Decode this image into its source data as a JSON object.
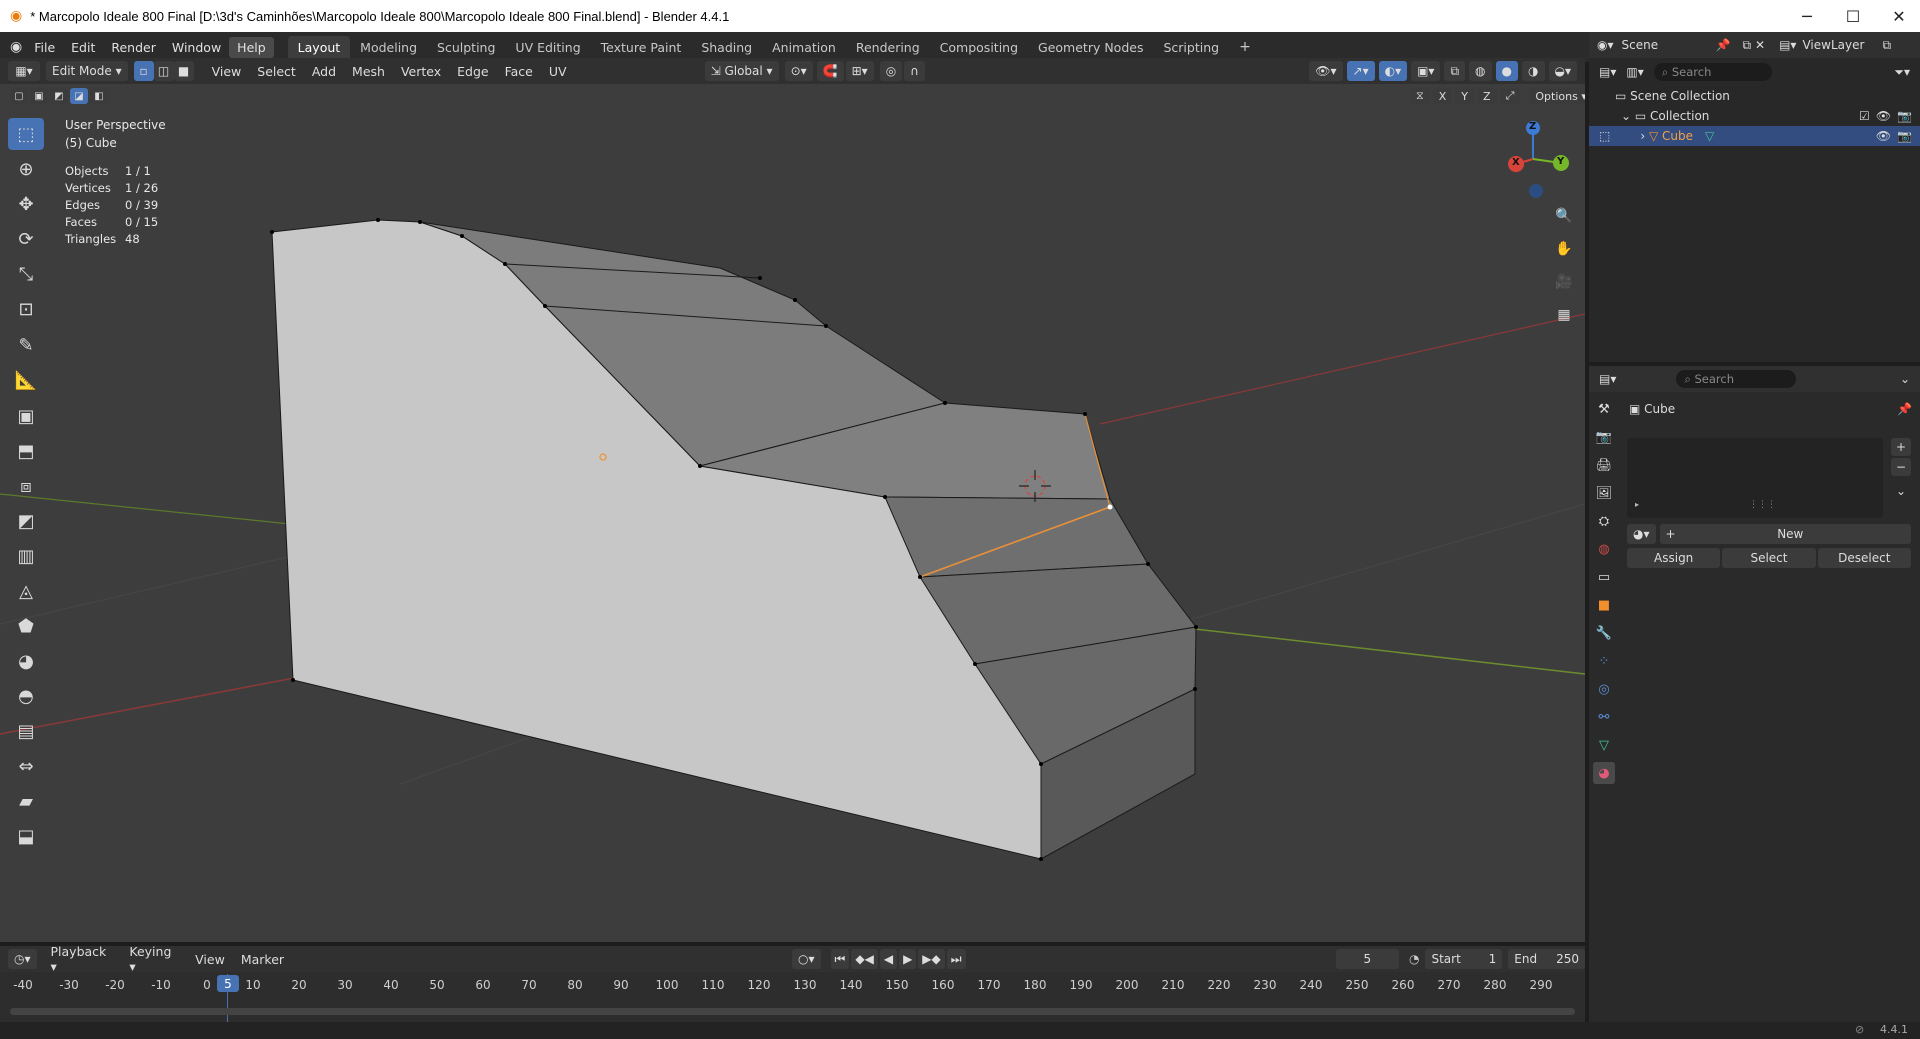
{
  "window": {
    "title": "* Marcopolo Ideale 800 Final [D:\\3d's Caminhões\\Marcopolo Ideale 800\\Marcopolo Ideale 800 Final.blend] - Blender 4.4.1"
  },
  "menu": [
    "File",
    "Edit",
    "Render",
    "Window",
    "Help"
  ],
  "workspaces": [
    "Layout",
    "Modeling",
    "Sculpting",
    "UV Editing",
    "Texture Paint",
    "Shading",
    "Animation",
    "Rendering",
    "Compositing",
    "Geometry Nodes",
    "Scripting"
  ],
  "active_workspace": "Layout",
  "viewport_header": {
    "mode": "Edit Mode",
    "menus": [
      "View",
      "Select",
      "Add",
      "Mesh",
      "Vertex",
      "Edge",
      "Face",
      "UV"
    ],
    "transform_orientation": "Global",
    "options_label": "Options",
    "axes": [
      "X",
      "Y",
      "Z"
    ]
  },
  "overlay": {
    "view_name": "User Perspective",
    "object_name": "(5) Cube",
    "stats": [
      {
        "label": "Objects",
        "value": "1 / 1"
      },
      {
        "label": "Vertices",
        "value": "1 / 26"
      },
      {
        "label": "Edges",
        "value": "0 / 39"
      },
      {
        "label": "Faces",
        "value": "0 / 15"
      },
      {
        "label": "Triangles",
        "value": "48"
      }
    ]
  },
  "gizmo": {
    "x": "X",
    "y": "Y",
    "z": "Z"
  },
  "outliner": {
    "scene_label": "Scene",
    "view_layer": "ViewLayer",
    "search_placeholder": "Search",
    "scene_collection": "Scene Collection",
    "collection": "Collection",
    "object": "Cube"
  },
  "properties": {
    "search_placeholder": "Search",
    "object_name": "Cube",
    "new_label": "New",
    "assign_label": "Assign",
    "select_label": "Select",
    "deselect_label": "Deselect"
  },
  "timeline": {
    "menus": [
      "Playback",
      "Keying",
      "View",
      "Marker"
    ],
    "current_frame": "5",
    "start_label": "Start",
    "start_value": "1",
    "end_label": "End",
    "end_value": "250",
    "ruler": [
      "-40",
      "-30",
      "-20",
      "-10",
      "0",
      "5",
      "10",
      "20",
      "30",
      "40",
      "50",
      "60",
      "70",
      "80",
      "90",
      "100",
      "110",
      "120",
      "130",
      "140",
      "150",
      "160",
      "170",
      "180",
      "190",
      "200",
      "210",
      "220",
      "230",
      "240",
      "250",
      "260",
      "270",
      "280",
      "290"
    ]
  },
  "status": {
    "version": "4.4.1"
  },
  "colors": {
    "accent": "#4772b3",
    "selected_edge": "#e8903a",
    "object_orange": "#f28f2d"
  }
}
